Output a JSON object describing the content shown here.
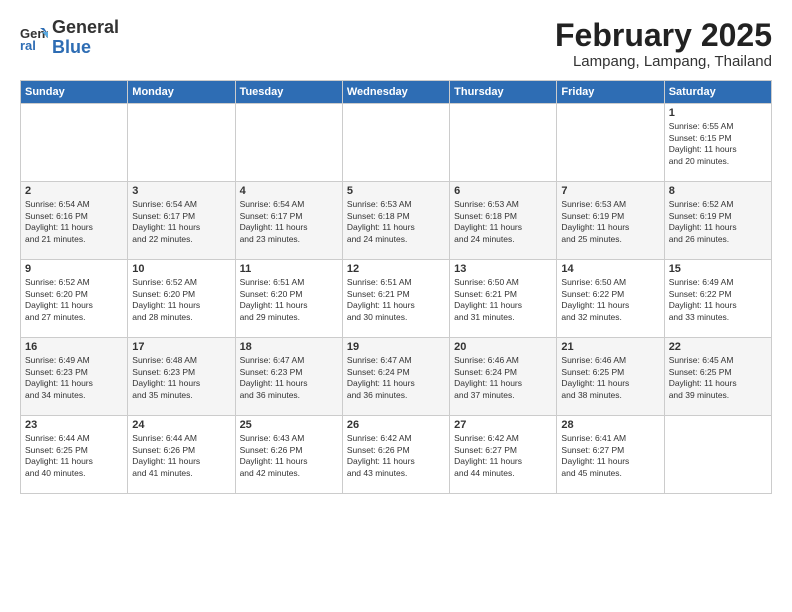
{
  "header": {
    "logo_general": "General",
    "logo_blue": "Blue",
    "month_title": "February 2025",
    "location": "Lampang, Lampang, Thailand"
  },
  "days_of_week": [
    "Sunday",
    "Monday",
    "Tuesday",
    "Wednesday",
    "Thursday",
    "Friday",
    "Saturday"
  ],
  "weeks": [
    {
      "days": [
        {
          "number": "",
          "info": ""
        },
        {
          "number": "",
          "info": ""
        },
        {
          "number": "",
          "info": ""
        },
        {
          "number": "",
          "info": ""
        },
        {
          "number": "",
          "info": ""
        },
        {
          "number": "",
          "info": ""
        },
        {
          "number": "1",
          "info": "Sunrise: 6:55 AM\nSunset: 6:15 PM\nDaylight: 11 hours\nand 20 minutes."
        }
      ]
    },
    {
      "days": [
        {
          "number": "2",
          "info": "Sunrise: 6:54 AM\nSunset: 6:16 PM\nDaylight: 11 hours\nand 21 minutes."
        },
        {
          "number": "3",
          "info": "Sunrise: 6:54 AM\nSunset: 6:17 PM\nDaylight: 11 hours\nand 22 minutes."
        },
        {
          "number": "4",
          "info": "Sunrise: 6:54 AM\nSunset: 6:17 PM\nDaylight: 11 hours\nand 23 minutes."
        },
        {
          "number": "5",
          "info": "Sunrise: 6:53 AM\nSunset: 6:18 PM\nDaylight: 11 hours\nand 24 minutes."
        },
        {
          "number": "6",
          "info": "Sunrise: 6:53 AM\nSunset: 6:18 PM\nDaylight: 11 hours\nand 24 minutes."
        },
        {
          "number": "7",
          "info": "Sunrise: 6:53 AM\nSunset: 6:19 PM\nDaylight: 11 hours\nand 25 minutes."
        },
        {
          "number": "8",
          "info": "Sunrise: 6:52 AM\nSunset: 6:19 PM\nDaylight: 11 hours\nand 26 minutes."
        }
      ]
    },
    {
      "days": [
        {
          "number": "9",
          "info": "Sunrise: 6:52 AM\nSunset: 6:20 PM\nDaylight: 11 hours\nand 27 minutes."
        },
        {
          "number": "10",
          "info": "Sunrise: 6:52 AM\nSunset: 6:20 PM\nDaylight: 11 hours\nand 28 minutes."
        },
        {
          "number": "11",
          "info": "Sunrise: 6:51 AM\nSunset: 6:20 PM\nDaylight: 11 hours\nand 29 minutes."
        },
        {
          "number": "12",
          "info": "Sunrise: 6:51 AM\nSunset: 6:21 PM\nDaylight: 11 hours\nand 30 minutes."
        },
        {
          "number": "13",
          "info": "Sunrise: 6:50 AM\nSunset: 6:21 PM\nDaylight: 11 hours\nand 31 minutes."
        },
        {
          "number": "14",
          "info": "Sunrise: 6:50 AM\nSunset: 6:22 PM\nDaylight: 11 hours\nand 32 minutes."
        },
        {
          "number": "15",
          "info": "Sunrise: 6:49 AM\nSunset: 6:22 PM\nDaylight: 11 hours\nand 33 minutes."
        }
      ]
    },
    {
      "days": [
        {
          "number": "16",
          "info": "Sunrise: 6:49 AM\nSunset: 6:23 PM\nDaylight: 11 hours\nand 34 minutes."
        },
        {
          "number": "17",
          "info": "Sunrise: 6:48 AM\nSunset: 6:23 PM\nDaylight: 11 hours\nand 35 minutes."
        },
        {
          "number": "18",
          "info": "Sunrise: 6:47 AM\nSunset: 6:23 PM\nDaylight: 11 hours\nand 36 minutes."
        },
        {
          "number": "19",
          "info": "Sunrise: 6:47 AM\nSunset: 6:24 PM\nDaylight: 11 hours\nand 36 minutes."
        },
        {
          "number": "20",
          "info": "Sunrise: 6:46 AM\nSunset: 6:24 PM\nDaylight: 11 hours\nand 37 minutes."
        },
        {
          "number": "21",
          "info": "Sunrise: 6:46 AM\nSunset: 6:25 PM\nDaylight: 11 hours\nand 38 minutes."
        },
        {
          "number": "22",
          "info": "Sunrise: 6:45 AM\nSunset: 6:25 PM\nDaylight: 11 hours\nand 39 minutes."
        }
      ]
    },
    {
      "days": [
        {
          "number": "23",
          "info": "Sunrise: 6:44 AM\nSunset: 6:25 PM\nDaylight: 11 hours\nand 40 minutes."
        },
        {
          "number": "24",
          "info": "Sunrise: 6:44 AM\nSunset: 6:26 PM\nDaylight: 11 hours\nand 41 minutes."
        },
        {
          "number": "25",
          "info": "Sunrise: 6:43 AM\nSunset: 6:26 PM\nDaylight: 11 hours\nand 42 minutes."
        },
        {
          "number": "26",
          "info": "Sunrise: 6:42 AM\nSunset: 6:26 PM\nDaylight: 11 hours\nand 43 minutes."
        },
        {
          "number": "27",
          "info": "Sunrise: 6:42 AM\nSunset: 6:27 PM\nDaylight: 11 hours\nand 44 minutes."
        },
        {
          "number": "28",
          "info": "Sunrise: 6:41 AM\nSunset: 6:27 PM\nDaylight: 11 hours\nand 45 minutes."
        },
        {
          "number": "",
          "info": ""
        }
      ]
    }
  ]
}
